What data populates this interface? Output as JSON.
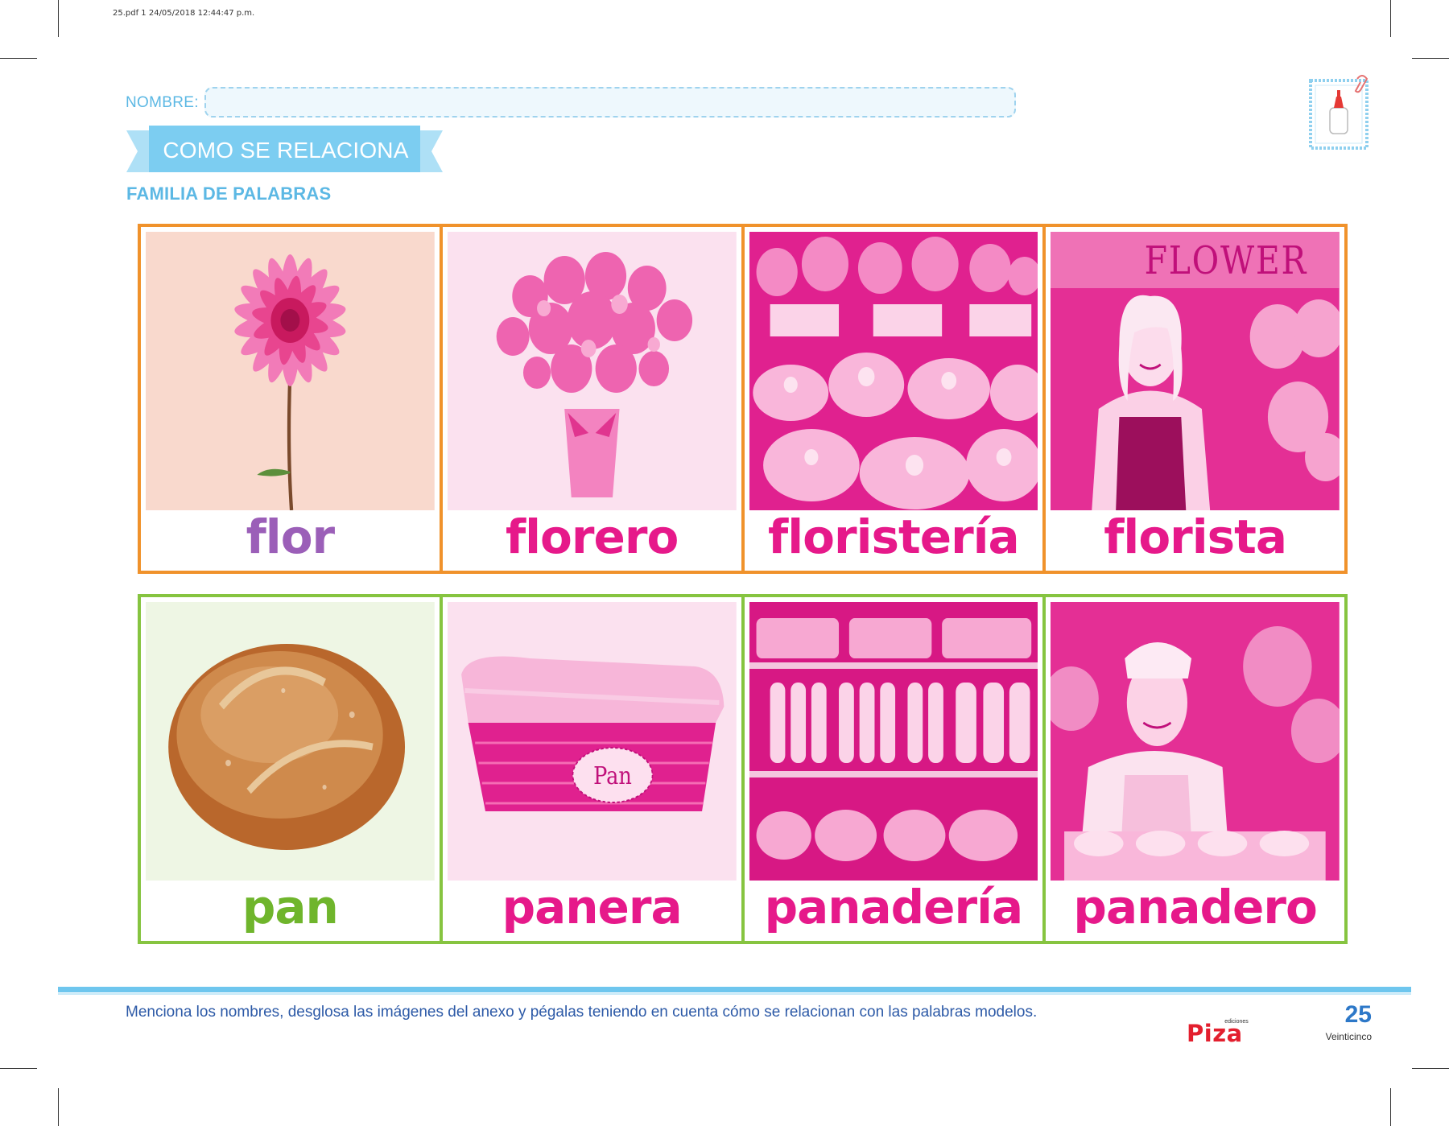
{
  "meta": {
    "print_info": "25.pdf   1   24/05/2018   12:44:47 p.m."
  },
  "header": {
    "nombre_label": "NOMBRE:",
    "title": "COMO SE RELACIONA",
    "subtitle": "FAMILIA DE PALABRAS",
    "glue_icon": "glue-bottle-icon"
  },
  "colors": {
    "accent_blue": "#5cb8e4",
    "row1_border": "#f0922b",
    "row2_border": "#86c440",
    "magenta": "#e6198a",
    "purple": "#9b5fb8",
    "green": "#6fb52c"
  },
  "rows": [
    {
      "words": [
        {
          "label": "flor",
          "color": "#9b5fb8",
          "image": "pink-dahlia-flower"
        },
        {
          "label": "florero",
          "color": "#e6198a",
          "image": "flower-vase-bouquet"
        },
        {
          "label": "floristería",
          "color": "#e6198a",
          "image": "flower-shop-display"
        },
        {
          "label": "florista",
          "color": "#e6198a",
          "image": "smiling-florist-woman"
        }
      ],
      "shop_sign": "FLOWER"
    },
    {
      "words": [
        {
          "label": "pan",
          "color": "#6fb52c",
          "image": "round-bread-loaf"
        },
        {
          "label": "panera",
          "color": "#e6198a",
          "image": "bread-basket"
        },
        {
          "label": "panadería",
          "color": "#e6198a",
          "image": "bakery-shelves"
        },
        {
          "label": "panadero",
          "color": "#e6198a",
          "image": "smiling-baker-man"
        }
      ],
      "basket_label": "Pan"
    }
  ],
  "footer": {
    "instruction": "Menciona los nombres, desglosa las imágenes del anexo y pégalas teniendo en cuenta cómo se relacionan con las palabras modelos.",
    "logo_small": "ediciones",
    "logo": "Piza",
    "page_number": "25",
    "page_word": "Veinticinco"
  }
}
